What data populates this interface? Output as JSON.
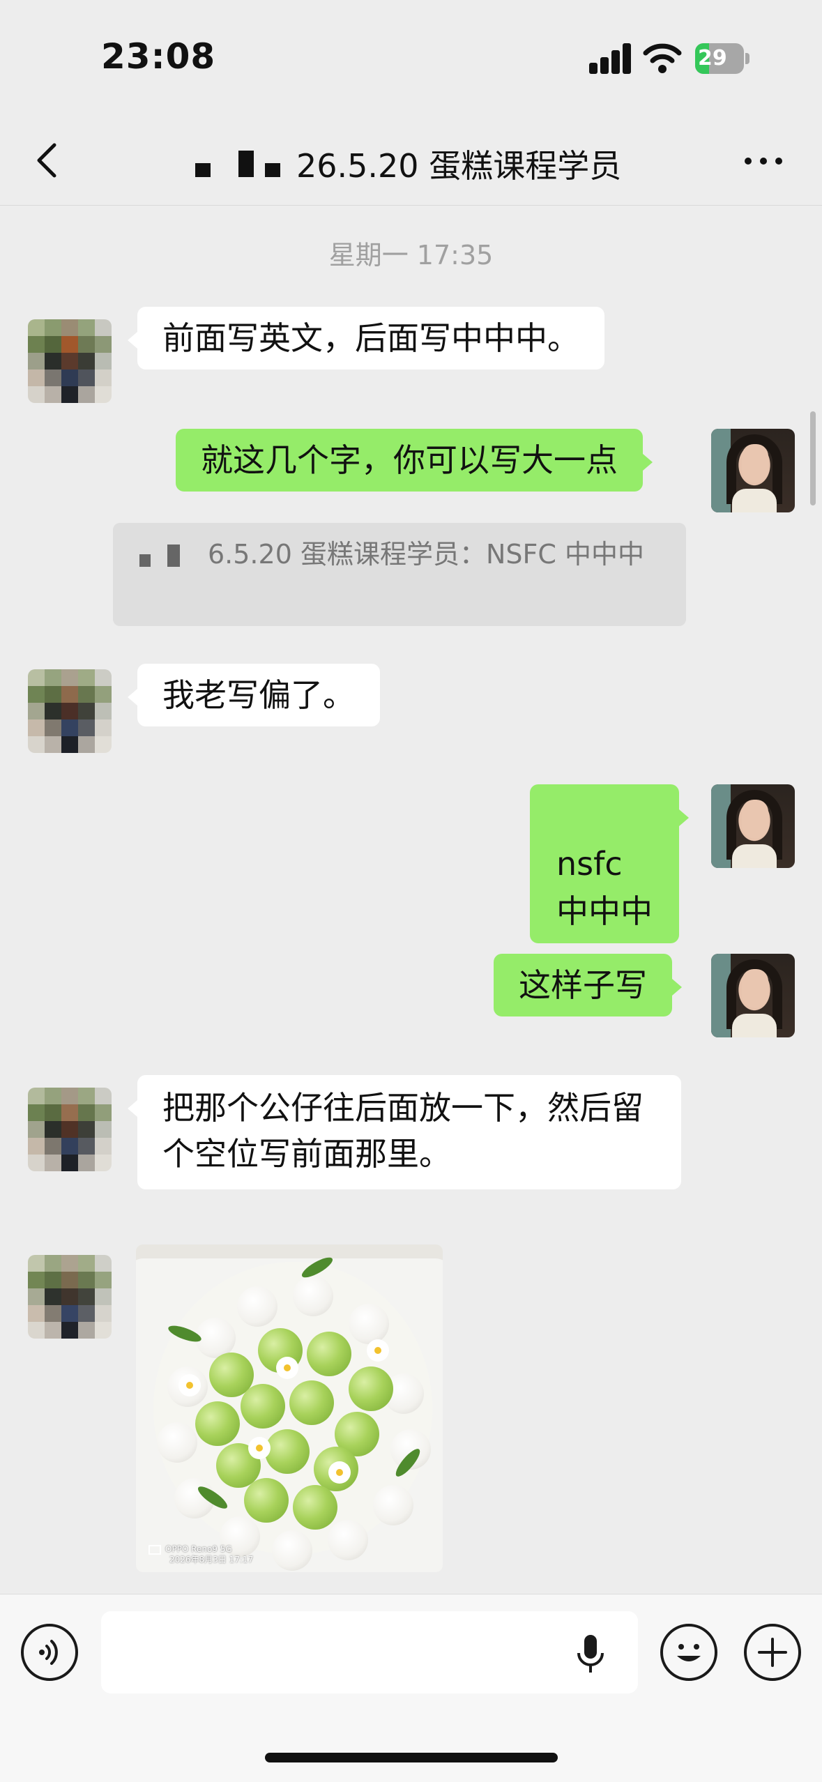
{
  "status_bar": {
    "time": "23:08",
    "battery_level": "29",
    "battery_fraction": 0.29,
    "colors": {
      "battery_fill": "#34c759"
    },
    "icons": [
      "signal-icon",
      "wifi-icon",
      "battery-icon"
    ]
  },
  "nav": {
    "title": "26.5.20 蛋糕课程学员",
    "icons": {
      "back": "chevron-left-icon",
      "more": "more-dots-icon"
    }
  },
  "chat": {
    "timestamp": "星期一 17:35",
    "messages": [
      {
        "side": "left",
        "text": "前面写英文，后面写中中中。"
      },
      {
        "side": "right",
        "text": "就这几个字，你可以写大一点"
      },
      {
        "side": "right",
        "type": "quote",
        "text": "6.5.20 蛋糕课程学员：NSFC  中中中"
      },
      {
        "side": "left",
        "text": "我老写偏了。"
      },
      {
        "side": "right",
        "text": "nsfc\n中中中"
      },
      {
        "side": "right",
        "text": "这样子写"
      },
      {
        "side": "left",
        "text": "把那个公仔往后面放一下，然后留个空位写前面那里。"
      },
      {
        "side": "left",
        "type": "image",
        "watermark_line1": "OPPO Reno9 5G",
        "watermark_line2": "2026年8月3日 17:17"
      }
    ],
    "colors": {
      "bubble_self": "#95ec69",
      "bubble_other": "#ffffff",
      "background": "#ededed"
    }
  },
  "input_bar": {
    "placeholder": "",
    "icons": {
      "voice": "voice-icon",
      "mic": "microphone-icon",
      "emoji": "emoji-icon",
      "plus": "plus-icon"
    }
  }
}
